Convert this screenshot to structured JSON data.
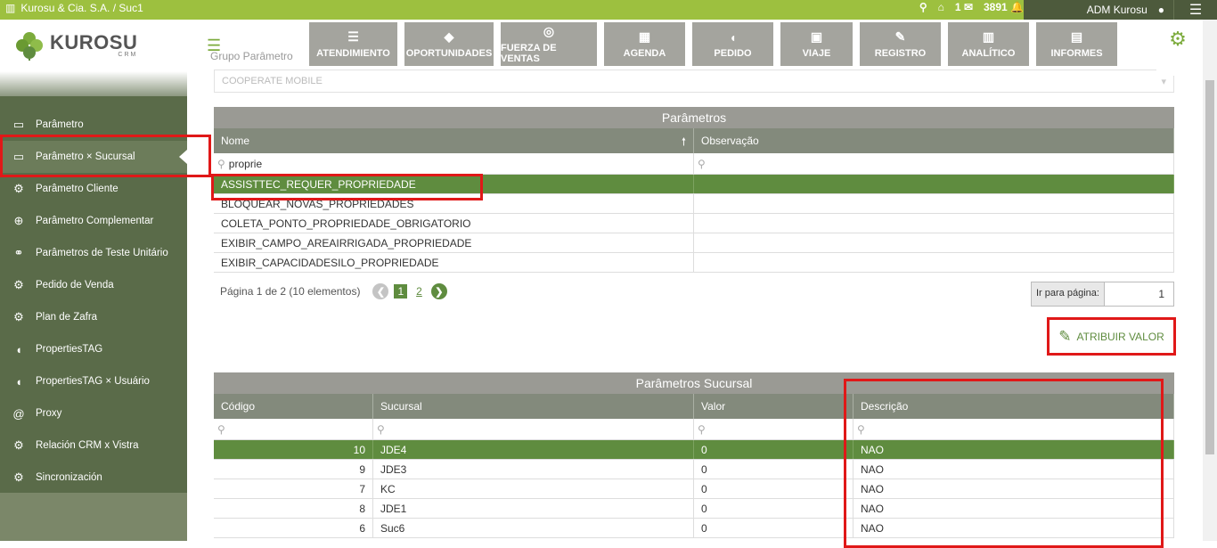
{
  "topbar": {
    "company": "Kurosu & Cia. S.A. / Suc1",
    "mail_count": "1",
    "notif_count": "3891",
    "user": "ADM Kurosu"
  },
  "logo": {
    "word": "KUROSU",
    "sub": "CRM"
  },
  "sidebar": {
    "items": [
      {
        "label": "Parâmetro",
        "icon": "laptop-icon"
      },
      {
        "label": "Parâmetro × Sucursal",
        "icon": "laptop-icon"
      },
      {
        "label": "Parâmetro Cliente",
        "icon": "cogs-icon"
      },
      {
        "label": "Parâmetro Complementar",
        "icon": "plus-circle-icon"
      },
      {
        "label": "Parâmetros de Teste Unitário",
        "icon": "bicycle-icon"
      },
      {
        "label": "Pedido de Venda",
        "icon": "cogs-icon"
      },
      {
        "label": "Plan de Zafra",
        "icon": "cogs-icon"
      },
      {
        "label": "PropertiesTAG",
        "icon": "tag-icon"
      },
      {
        "label": "PropertiesTAG × Usuário",
        "icon": "tags-icon"
      },
      {
        "label": "Proxy",
        "icon": "at-icon"
      },
      {
        "label": "Relación CRM x Vistra",
        "icon": "cogs-icon"
      },
      {
        "label": "Sincronización",
        "icon": "cogs-icon"
      }
    ]
  },
  "menu": [
    {
      "label": "ATENDIMIENTO",
      "icon": "list-check-icon",
      "glyph": "☰"
    },
    {
      "label": "OPORTUNIDADES",
      "icon": "diamond-icon",
      "glyph": "◆"
    },
    {
      "label": "FUERZA DE VENTAS",
      "icon": "target-icon",
      "glyph": "◎"
    },
    {
      "label": "AGENDA",
      "icon": "calendar-icon",
      "glyph": "▦"
    },
    {
      "label": "PEDIDO",
      "icon": "tag-icon",
      "glyph": "◖"
    },
    {
      "label": "VIAJE",
      "icon": "briefcase-icon",
      "glyph": "▣"
    },
    {
      "label": "REGISTRO",
      "icon": "edit-icon",
      "glyph": "✎"
    },
    {
      "label": "ANALÍTICO",
      "icon": "bar-chart-icon",
      "glyph": "▥"
    },
    {
      "label": "INFORMES",
      "icon": "list-alt-icon",
      "glyph": "▤"
    }
  ],
  "group": {
    "label": "Grupo Parâmetro",
    "value": "COOPERATE MOBILE"
  },
  "parametros": {
    "title": "Parâmetros",
    "col_nome": "Nome",
    "col_obs": "Observação",
    "filter_value": "proprie",
    "rows": [
      {
        "nome": "ASSISTTEC_REQUER_PROPRIEDADE",
        "obs": ""
      },
      {
        "nome": "BLOQUEAR_NOVAS_PROPRIEDADES",
        "obs": ""
      },
      {
        "nome": "COLETA_PONTO_PROPRIEDADE_OBRIGATORIO",
        "obs": ""
      },
      {
        "nome": "EXIBIR_CAMPO_AREAIRRIGADA_PROPRIEDADE",
        "obs": ""
      },
      {
        "nome": "EXIBIR_CAPACIDADESILO_PROPRIEDADE",
        "obs": ""
      }
    ]
  },
  "pager": {
    "text": "Página 1 de 2 (10 elementos)",
    "page1": "1",
    "page2": "2",
    "goto_label": "Ir para página:",
    "goto_value": "1"
  },
  "atribuir": {
    "label": "ATRIBUIR VALOR"
  },
  "sucursal": {
    "title": "Parâmetros Sucursal",
    "cols": [
      "Código",
      "Sucursal",
      "Valor",
      "Descrição"
    ],
    "rows": [
      {
        "codigo": "10",
        "sucursal": "JDE4",
        "valor": "0",
        "descricao": "NAO"
      },
      {
        "codigo": "9",
        "sucursal": "JDE3",
        "valor": "0",
        "descricao": "NAO"
      },
      {
        "codigo": "7",
        "sucursal": "KC",
        "valor": "0",
        "descricao": "NAO"
      },
      {
        "codigo": "8",
        "sucursal": "JDE1",
        "valor": "0",
        "descricao": "NAO"
      },
      {
        "codigo": "6",
        "sucursal": "Suc6",
        "valor": "0",
        "descricao": "NAO"
      }
    ]
  },
  "colors": {
    "brand_green": "#9dc03f",
    "selected_row": "#5f8c3f",
    "sidebar": "#5a6b49",
    "highlight": "#e01818"
  }
}
